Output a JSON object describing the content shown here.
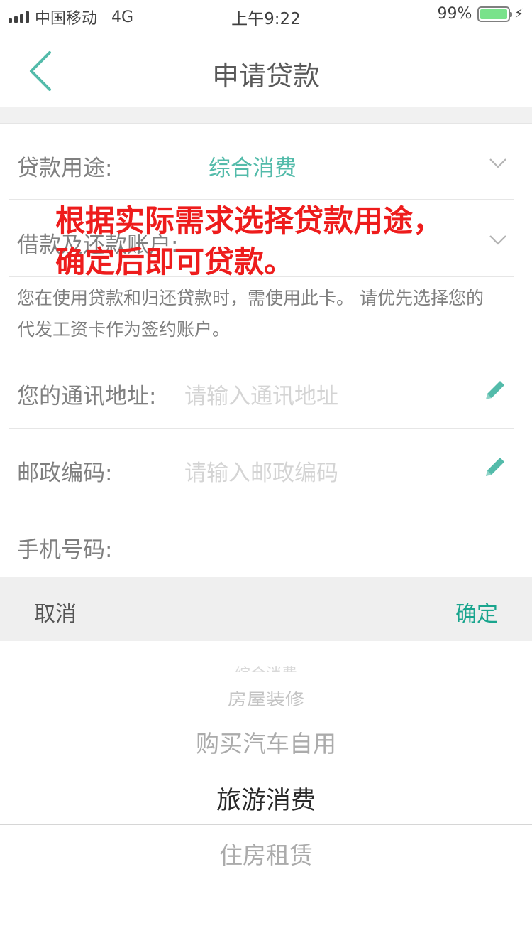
{
  "status_bar": {
    "carrier": "中国移动",
    "network": "4G",
    "time": "上午9:22",
    "battery": "99%",
    "battery_level": 0.99
  },
  "header": {
    "title": "申请贷款",
    "back_icon": "chevron-left-icon"
  },
  "form": {
    "purpose_label": "贷款用途:",
    "purpose_value": "综合消费",
    "account_label": "借款及还款账户:",
    "account_note": "您在使用贷款和归还贷款时，需使用此卡。 请优先选择您的代发工资卡作为签约账户。",
    "address_label": "您的通讯地址:",
    "address_placeholder": "请输入通讯地址",
    "postal_label": "邮政编码:",
    "postal_placeholder": "请输入邮政编码",
    "phone_label": "手机号码:"
  },
  "annotation": {
    "line1": "根据实际需求选择贷款用途，",
    "line2": "确定后即可贷款。"
  },
  "picker": {
    "cancel_label": "取消",
    "confirm_label": "确定",
    "options": [
      "综合消费",
      "房屋装修",
      "购买汽车自用",
      "旅游消费",
      "住房租赁"
    ],
    "selected": "旅游消费"
  },
  "colors": {
    "accent": "#1aa58e",
    "annotation": "#ee1c1c",
    "battery": "#4cd964"
  }
}
